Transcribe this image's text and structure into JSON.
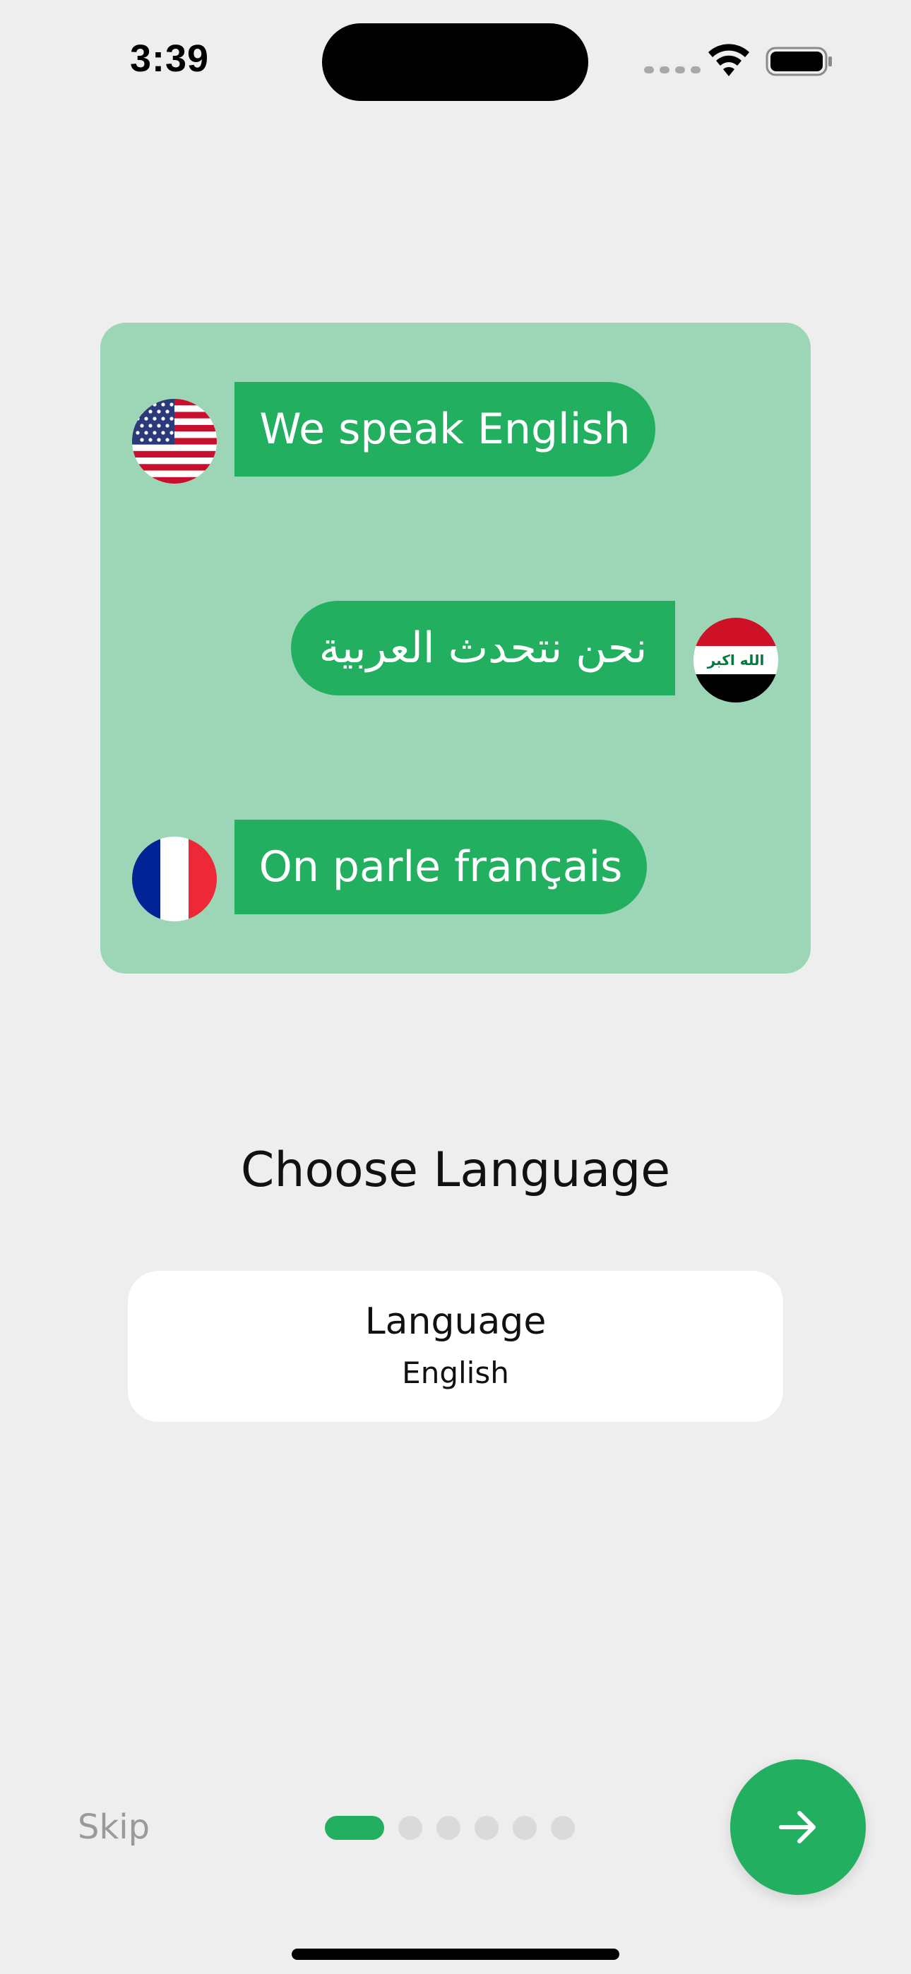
{
  "status_bar": {
    "time": "3:39"
  },
  "illustration": {
    "messages": [
      {
        "text": "We speak English",
        "flag_icon": "us-flag-icon"
      },
      {
        "text": "نحن نتحدث العربية",
        "flag_icon": "iraq-flag-icon",
        "flag_text": "الله اكبر"
      },
      {
        "text": "On parle français",
        "flag_icon": "france-flag-icon"
      }
    ]
  },
  "title": "Choose Language",
  "language_selector": {
    "label": "Language",
    "value": "English"
  },
  "footer": {
    "skip_label": "Skip",
    "page_indicator": {
      "total": 6,
      "current": 1
    }
  },
  "colors": {
    "accent": "#22b060",
    "card_background": "#9dd6b6",
    "page_background": "#eeeeee"
  }
}
